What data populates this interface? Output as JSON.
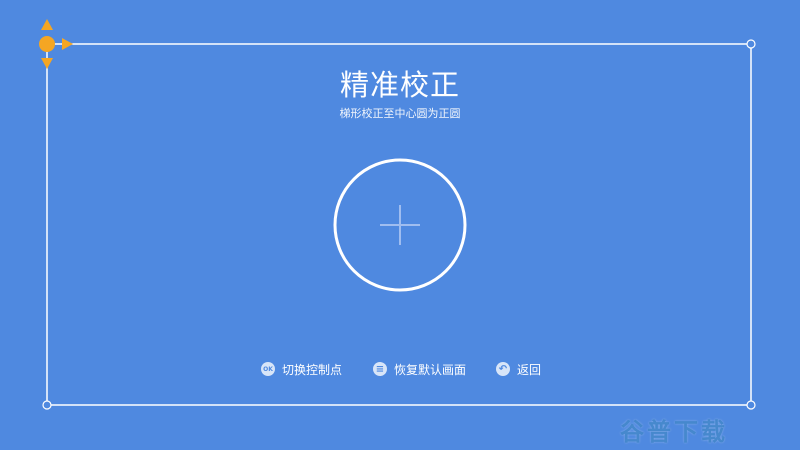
{
  "screen": {
    "title": "精准校正",
    "subtitle": "梯形校正至中心圆为正圆"
  },
  "controls": {
    "switch_point": {
      "badge": "OK",
      "label": "切换控制点"
    },
    "restore_default": {
      "badge": "≡",
      "label": "恢复默认画面"
    },
    "back": {
      "badge": "↶",
      "label": "返回"
    }
  },
  "watermark": {
    "text": "谷普下载"
  },
  "colors": {
    "background": "#4f89e0",
    "frame_line": "#ffffff",
    "active_handle": "#f5a623",
    "crosshair": "#9fbdf0"
  },
  "icons": {
    "active_corner": "move-arrows-icon",
    "center_target": "crosshair-icon"
  }
}
